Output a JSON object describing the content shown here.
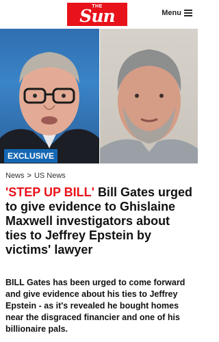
{
  "header": {
    "logo_small": "THE",
    "logo_main": "Sun",
    "menu_label": "Menu"
  },
  "hero": {
    "badge": "EXCLUSIVE"
  },
  "breadcrumb": {
    "items": [
      "News",
      "US News"
    ],
    "separator": ">"
  },
  "article": {
    "kicker": "'STEP UP BILL'",
    "headline": "Bill Gates urged to give evidence to Ghislaine Maxwell investigators about ties to Jeffrey Epstein by victims' lawyer",
    "standfirst": "BILL Gates has been urged to come forward and give evidence about his ties to Jeffrey Epstein - as it's revealed he bought homes near the disgraced financier and one of his billionaire pals."
  },
  "colors": {
    "brand_red": "#e8121a",
    "badge_blue": "#1467b3"
  }
}
